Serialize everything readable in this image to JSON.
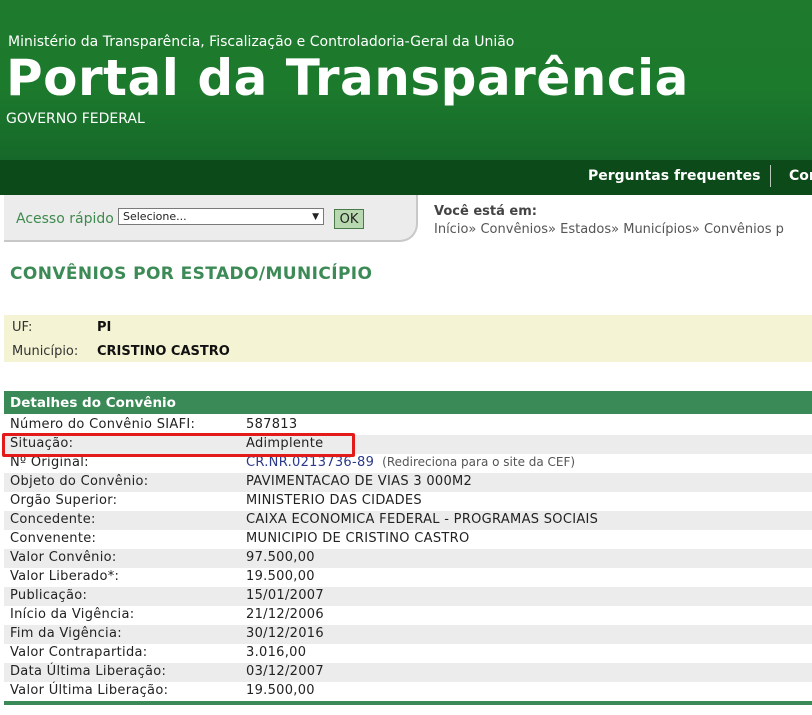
{
  "header": {
    "ministerio": "Ministério da Transparência, Fiscalização e Controladoria-Geral da União",
    "portal_title": "Portal da Transparência",
    "governo": "GOVERNO FEDERAL"
  },
  "nav": {
    "faq": "Perguntas frequentes",
    "next": "Con"
  },
  "quick_access": {
    "label": "Acesso rápido",
    "select_value": "Selecione...",
    "ok_label": "OK"
  },
  "breadcrumb": {
    "label": "Você está em:",
    "path": "Início» Convênios» Estados» Municípios» Convênios p"
  },
  "page_title": "CONVÊNIOS POR ESTADO/MUNICÍPIO",
  "location": {
    "uf_label": "UF:",
    "uf_value": "PI",
    "municipio_label": "Município:",
    "municipio_value": "CRISTINO CASTRO"
  },
  "section_title": "Detalhes do Convênio",
  "details": [
    {
      "label": "Número do Convênio SIAFI:",
      "value": "587813"
    },
    {
      "label": "Situação:",
      "value": "Adimplente"
    },
    {
      "label": "Nº Original:",
      "value": "CR.NR.0213736-89",
      "note": "(Redireciona para o site da CEF)"
    },
    {
      "label": "Objeto do Convênio:",
      "value": "PAVIMENTACAO DE VIAS 3 000M2"
    },
    {
      "label": "Orgão Superior:",
      "value": "MINISTERIO DAS CIDADES"
    },
    {
      "label": "Concedente:",
      "value": "CAIXA ECONOMICA FEDERAL - PROGRAMAS SOCIAIS"
    },
    {
      "label": "Convenente:",
      "value": "MUNICIPIO DE CRISTINO CASTRO"
    },
    {
      "label": "Valor Convênio:",
      "value": "97.500,00"
    },
    {
      "label": "Valor Liberado*:",
      "value": "19.500,00"
    },
    {
      "label": "Publicação:",
      "value": "15/01/2007"
    },
    {
      "label": "Início da Vigência:",
      "value": "21/12/2006"
    },
    {
      "label": "Fim da Vigência:",
      "value": "30/12/2016"
    },
    {
      "label": "Valor Contrapartida:",
      "value": "3.016,00"
    },
    {
      "label": "Data Última Liberação:",
      "value": "03/12/2007"
    },
    {
      "label": "Valor Última Liberação:",
      "value": "19.500,00"
    }
  ],
  "colors": {
    "header_green": "#1c7a2c",
    "nav_dark_green": "#0d4a1a",
    "section_green": "#3a8a58",
    "highlight_red": "#e21a1a",
    "link_blue": "#2a3a8a"
  }
}
